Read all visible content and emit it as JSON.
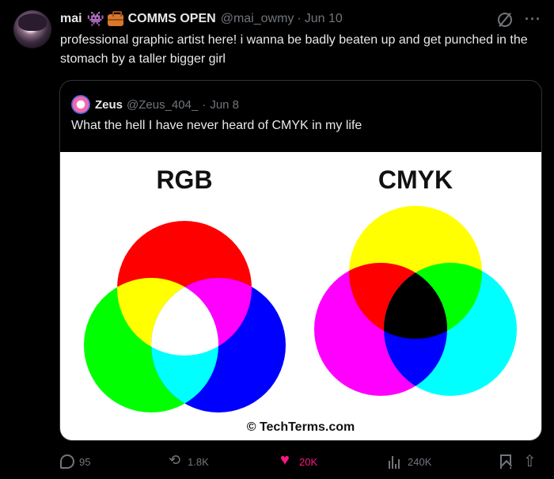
{
  "tweet": {
    "author_name": "mai",
    "author_tag": "COMMS OPEN",
    "handle": "@mai_owmy",
    "separator": "·",
    "date": "Jun 10",
    "text": "professional graphic artist here! i wanna be badly beaten up and get punched in the stomach by a taller bigger girl",
    "icons": [
      "alien-emoji-icon",
      "briefcase-emoji-icon",
      "grok-icon",
      "more-icon"
    ]
  },
  "quote": {
    "author_name": "Zeus",
    "handle": "@Zeus_404_",
    "separator": "·",
    "date": "Jun 8",
    "text": "What the hell I have never heard of CMYK in my life",
    "image": {
      "left_title": "RGB",
      "right_title": "CMYK",
      "credit": "© TechTerms.com",
      "rgb_colors": {
        "red": "#ff0000",
        "green": "#00ff00",
        "blue": "#0000ff",
        "yellow": "#ffff00",
        "cyan": "#00ffff",
        "magenta": "#ff00ff",
        "white": "#ffffff"
      },
      "cmyk_colors": {
        "yellow": "#ffff00",
        "magenta": "#ff00ff",
        "cyan": "#00ffff",
        "red": "#ff0000",
        "green": "#00ff00",
        "blue": "#0000ff",
        "black": "#000000"
      }
    }
  },
  "actions": {
    "replies": "95",
    "retweets": "1.8K",
    "likes": "20K",
    "views": "240K",
    "like_color": "#f91880"
  }
}
